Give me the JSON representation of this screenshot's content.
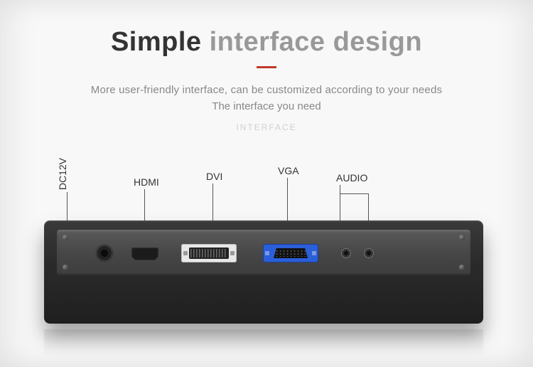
{
  "headline_dark": "Simple",
  "headline_light": "interface design",
  "subhead1": "More user-friendly interface, can be customized according to your needs",
  "subhead2": "The interface you need",
  "watermark": "INTERFACE",
  "ports": {
    "dc": "DC12V",
    "hdmi": "HDMI",
    "dvi": "DVI",
    "vga": "VGA",
    "audio": "AUDIO"
  }
}
